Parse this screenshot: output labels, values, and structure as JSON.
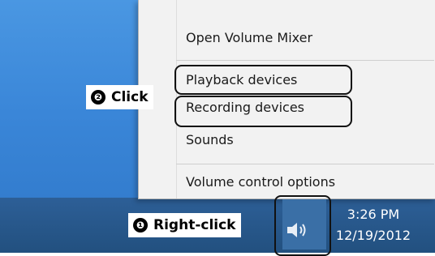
{
  "context_menu": {
    "items": [
      {
        "label": "Open Volume Mixer"
      },
      {
        "label": "Playback devices"
      },
      {
        "label": "Recording devices"
      },
      {
        "label": "Sounds"
      },
      {
        "label": "Volume control options"
      }
    ]
  },
  "annotations": {
    "step1": {
      "number": "❶",
      "text": "Right-click"
    },
    "step2": {
      "number": "❷",
      "text": "Click"
    }
  },
  "tray": {
    "icon": "speaker-volume-icon",
    "time": "3:26 PM",
    "date": "12/19/2012"
  },
  "colors": {
    "desktop": "#3a86d8",
    "taskbar": "#22507f",
    "menu_bg": "#f2f2f2",
    "annotation_border": "#111111"
  }
}
